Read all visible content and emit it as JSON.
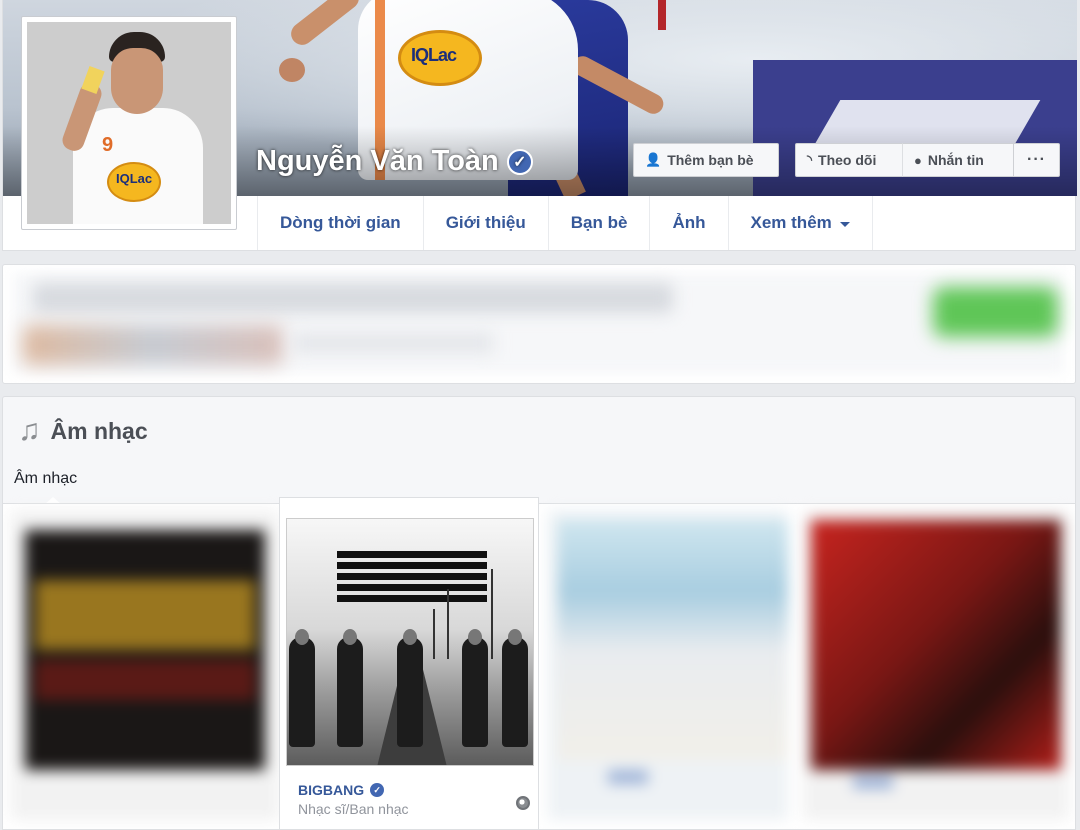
{
  "profile": {
    "name": "Nguyễn Văn Toàn",
    "verified": true
  },
  "actions": {
    "add_friend": "Thêm bạn bè",
    "follow": "Theo dõi",
    "message": "Nhắn tin",
    "more": "···"
  },
  "nav": {
    "tabs": [
      {
        "label": "Dòng thời gian"
      },
      {
        "label": "Giới thiệu"
      },
      {
        "label": "Bạn bè"
      },
      {
        "label": "Ảnh"
      },
      {
        "label": "Xem thêm"
      }
    ]
  },
  "music": {
    "title": "Âm nhạc",
    "subtab": "Âm nhạc",
    "featured": {
      "name": "BIGBANG",
      "category": "Nhạc sĩ/Ban nhạc"
    }
  },
  "colors": {
    "link_blue": "#365899",
    "badge_blue": "#4267b2",
    "page_bg": "#e9ebee"
  },
  "icons": [
    "add-friend-icon",
    "rss-icon",
    "messenger-icon",
    "music-note-icon",
    "globe-icon",
    "verified-icon"
  ]
}
